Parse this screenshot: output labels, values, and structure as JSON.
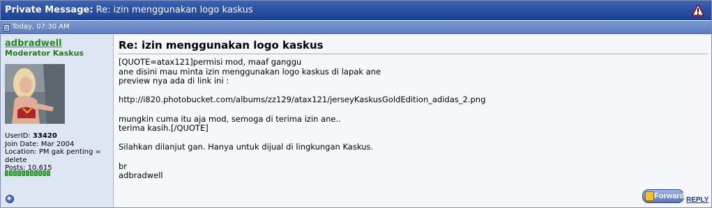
{
  "window": {
    "title_prefix": "Private Message:",
    "title_subject": "Re: izin menggunakan logo kaskus"
  },
  "post": {
    "date": "Today, 07:30 AM",
    "title": "Re: izin menggunakan logo kaskus",
    "body": "[QUOTE=atax121]permisi mod, maaf ganggu\nane disini mau minta izin menggunakan logo kaskus di lapak ane\npreview nya ada di link ini :\n\nhttp://i820.photobucket.com/albums/zz129/atax121/jerseyKaskusGoldEdition_adidas_2.png\n\nmungkin cuma itu aja mod, semoga di terima izin ane..\nterima kasih.[/QUOTE]\n\nSilahkan dilanjut gan. Hanya untuk dijual di lingkungan Kaskus.\n\nbr\nadbradwell"
  },
  "user": {
    "name": "adbradwell",
    "title": "Moderator Kaskus",
    "userid_label": "UserID:",
    "userid": "33420",
    "join_date": "Join Date: Mar 2004",
    "location": "Location: PM gak penting = delete",
    "posts": "Posts: 10,615",
    "reputation_pips": 11
  },
  "actions": {
    "forward_label": "Forward",
    "reply_label": "REPLY"
  },
  "icons": {
    "warning": "warning-triangle-icon",
    "document": "document-icon",
    "online_status": "online-status-icon",
    "forward": "forward-icon"
  },
  "colors": {
    "titlebar": "#2a50a3",
    "username": "#1f8a1f",
    "link": "#1a3da0"
  }
}
